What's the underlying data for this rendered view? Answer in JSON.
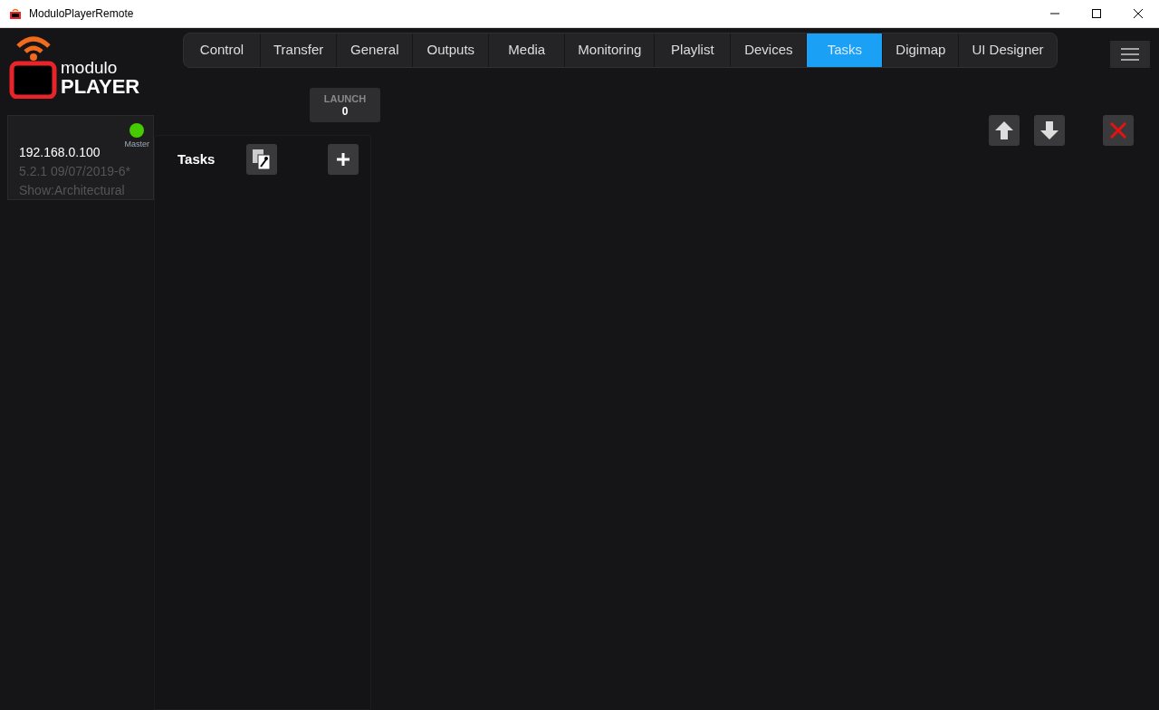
{
  "window": {
    "title": "ModuloPlayerRemote"
  },
  "logo": {
    "line1": "modulo",
    "line2": "PLAYER"
  },
  "tabs": [
    {
      "label": "Control",
      "selected": false
    },
    {
      "label": "Transfer",
      "selected": false
    },
    {
      "label": "General",
      "selected": false
    },
    {
      "label": "Outputs",
      "selected": false
    },
    {
      "label": "Media",
      "selected": false
    },
    {
      "label": "Monitoring",
      "selected": false
    },
    {
      "label": "Playlist",
      "selected": false
    },
    {
      "label": "Devices",
      "selected": false
    },
    {
      "label": "Tasks",
      "selected": true
    },
    {
      "label": "Digimap",
      "selected": false
    },
    {
      "label": "UI Designer",
      "selected": false
    }
  ],
  "launch": {
    "label": "LAUNCH",
    "count": "0"
  },
  "device": {
    "ip": "192.168.0.100",
    "version": "5.2.1 09/07/2019-6*",
    "show": "Show:Architectural",
    "role": "Master",
    "online": true
  },
  "tasks_panel": {
    "title": "Tasks"
  }
}
